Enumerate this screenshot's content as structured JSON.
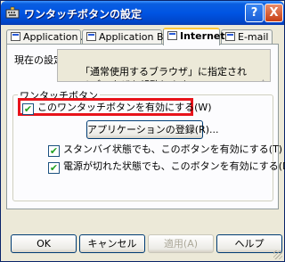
{
  "window": {
    "title": "ワンタッチボタンの設定"
  },
  "title_buttons": {
    "help": "?",
    "close": "X"
  },
  "tabs": [
    {
      "label": "Application A"
    },
    {
      "label": "Application B"
    },
    {
      "label": "Internet"
    },
    {
      "label": "E-mail"
    }
  ],
  "active_tab": "Internet",
  "setting": {
    "label": "現在の設定",
    "text": "「通常使用するブラウザ」に指定されているブラウザを起動します。"
  },
  "group": {
    "legend": "ワンタッチボタン",
    "enable": {
      "label": "このワンタッチボタンを有効にする(W)",
      "checked": true
    },
    "register_button": "アプリケーションの登録(R)...",
    "standby": {
      "label": "スタンバイ状態でも、このボタンを有効にする(T)",
      "checked": true
    },
    "poweroff": {
      "label": "電源が切れた状態でも、このボタンを有効にする(D)",
      "checked": true
    }
  },
  "footer": {
    "ok": "OK",
    "cancel": "キャンセル",
    "apply": "適用(A)",
    "help": "ヘルプ"
  },
  "colors": {
    "highlight": "#e8141b",
    "title_bar": "#0054e3",
    "dialog_bg": "#ece9d8"
  },
  "check_glyph": "✔"
}
